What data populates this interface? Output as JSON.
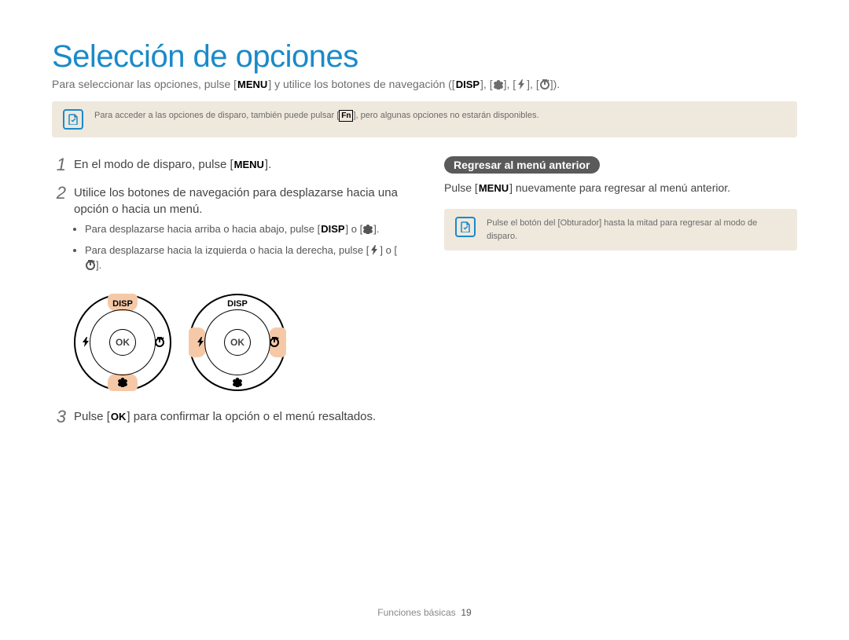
{
  "title": "Selección de opciones",
  "intro": {
    "pre": "Para seleccionar las opciones, pulse [",
    "menu": "MENU",
    "mid1": "] y utilice los botones de navegación ([",
    "disp": "DISP",
    "mid2": "], [",
    "mid3": "], [",
    "mid4": "], [",
    "end": "])."
  },
  "top_note": {
    "pre": "Para acceder a las opciones de disparo, también puede pulsar [",
    "fn": "Fn",
    "post": "], pero algunas opciones no estarán disponibles."
  },
  "steps": {
    "s1": {
      "num": "1",
      "pre": "En el modo de disparo, pulse [",
      "menu": "MENU",
      "post": "]."
    },
    "s2": {
      "num": "2",
      "text": "Utilice los botones de navegación para desplazarse hacia una opción o hacia un menú.",
      "b1": {
        "pre": "Para desplazarse hacia arriba o hacia abajo, pulse [",
        "disp": "DISP",
        "mid": "] o [",
        "post": "]."
      },
      "b2": {
        "pre": "Para desplazarse hacia la izquierda o hacia la derecha, pulse [",
        "mid": "] o [",
        "post": "]."
      }
    },
    "s3": {
      "num": "3",
      "pre": "Pulse [",
      "ok": "OK",
      "post": "] para confirmar la opción o el menú resaltados."
    }
  },
  "dial": {
    "ok": "OK",
    "disp": "DISP"
  },
  "right": {
    "pill": "Regresar al menú anterior",
    "para": {
      "pre": "Pulse [",
      "menu": "MENU",
      "post": "] nuevamente para regresar al menú anterior."
    },
    "note": {
      "pre": "Pulse el botón del [",
      "bold": "Obturador",
      "post": "] hasta la mitad para regresar al modo de disparo."
    }
  },
  "footer": {
    "section": "Funciones básicas",
    "page": "19"
  }
}
